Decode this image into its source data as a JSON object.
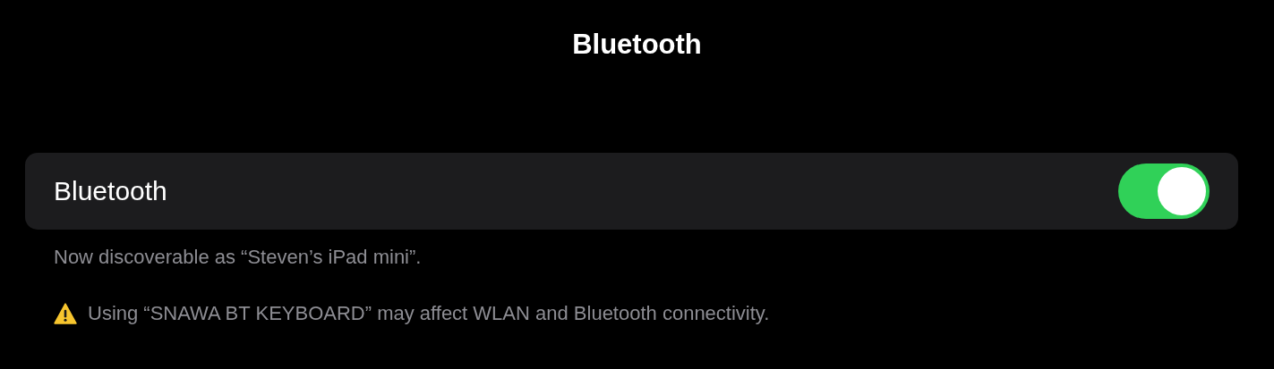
{
  "navigation_bar": {
    "title": "Bluetooth"
  },
  "bluetooth_row": {
    "label": "Bluetooth",
    "on": true
  },
  "footer_note": "Now discoverable as “Steven’s iPad mini”.",
  "warning": {
    "text": "Using “SNAWA BT KEYBOARD” may affect WLAN and Bluetooth connectivity."
  }
}
